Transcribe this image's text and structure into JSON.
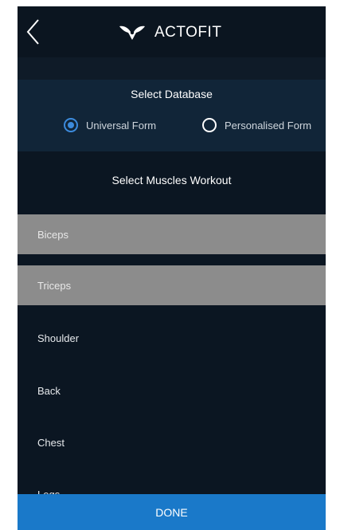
{
  "header": {
    "brand": "ACTOFIT",
    "back_icon": "chevron-left-icon",
    "logo_icon": "actofit-logo-icon"
  },
  "database": {
    "title": "Select Database",
    "options": [
      {
        "label": "Universal Form",
        "selected": true
      },
      {
        "label": "Personalised Form",
        "selected": false
      }
    ]
  },
  "muscles": {
    "title": "Select Muscles Workout",
    "items": [
      {
        "label": "Biceps",
        "selected": true
      },
      {
        "label": "Triceps",
        "selected": true
      },
      {
        "label": "Shoulder",
        "selected": false
      },
      {
        "label": "Back",
        "selected": false
      },
      {
        "label": "Chest",
        "selected": false
      },
      {
        "label": "Legs",
        "selected": false
      }
    ]
  },
  "done_label": "DONE",
  "colors": {
    "background": "#0b1622",
    "panel": "#112538",
    "selected_row": "#8c8c8c",
    "accent": "#1a79c9",
    "radio_selected": "#3c8bdc"
  }
}
